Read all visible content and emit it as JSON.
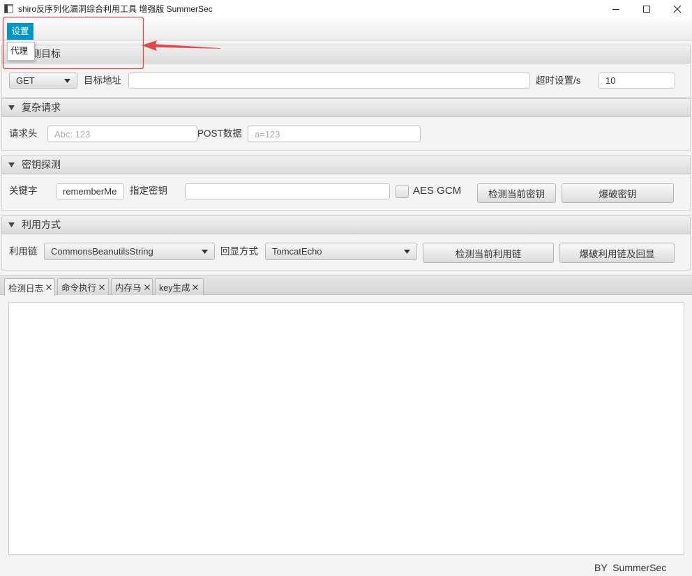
{
  "window": {
    "title": "shiro反序列化漏洞综合利用工具 增强版 SummerSec"
  },
  "icons": {
    "app": "app-window-icon",
    "minimize": "minimize-icon",
    "maximize": "maximize-icon",
    "close": "close-icon",
    "section_toggle": "chevron-down-icon",
    "combo_arrow": "dropdown-arrow-icon",
    "tab_close": "tab-close-icon"
  },
  "menu": {
    "settings": "设置",
    "settings_items": [
      "代理"
    ]
  },
  "target": {
    "title": "检测目标",
    "method": "GET",
    "url_label": "目标地址",
    "timeout_label": "超时设置/s",
    "timeout_value": "10"
  },
  "complex_request": {
    "title": "复杂请求",
    "headers_label": "请求头",
    "headers_placeholder": "Abc: 123",
    "post_label": "POST数据",
    "post_placeholder": "a=123"
  },
  "key_detect": {
    "title": "密钥探测",
    "keyword_label": "关键字",
    "keyword_value": "rememberMe",
    "key_label": "指定密钥",
    "aes_gcm_label": "AES GCM",
    "aes_gcm_checked": false,
    "check_button": "检测当前密钥",
    "brute_button": "爆破密钥"
  },
  "exploit": {
    "title": "利用方式",
    "chain_label": "利用链",
    "chain_value": "CommonsBeanutilsString",
    "echo_label": "回显方式",
    "echo_value": "TomcatEcho",
    "check_button": "检测当前利用链",
    "brute_button": "爆破利用链及回显"
  },
  "tabs": {
    "selected": 0,
    "items": [
      {
        "label": "检测日志"
      },
      {
        "label": "命令执行"
      },
      {
        "label": "内存马"
      },
      {
        "label": "key生成"
      }
    ]
  },
  "footer": {
    "text": "BY  SummerSec"
  },
  "colors": {
    "accent": "#0096c9",
    "annotation": "#e8474a"
  }
}
